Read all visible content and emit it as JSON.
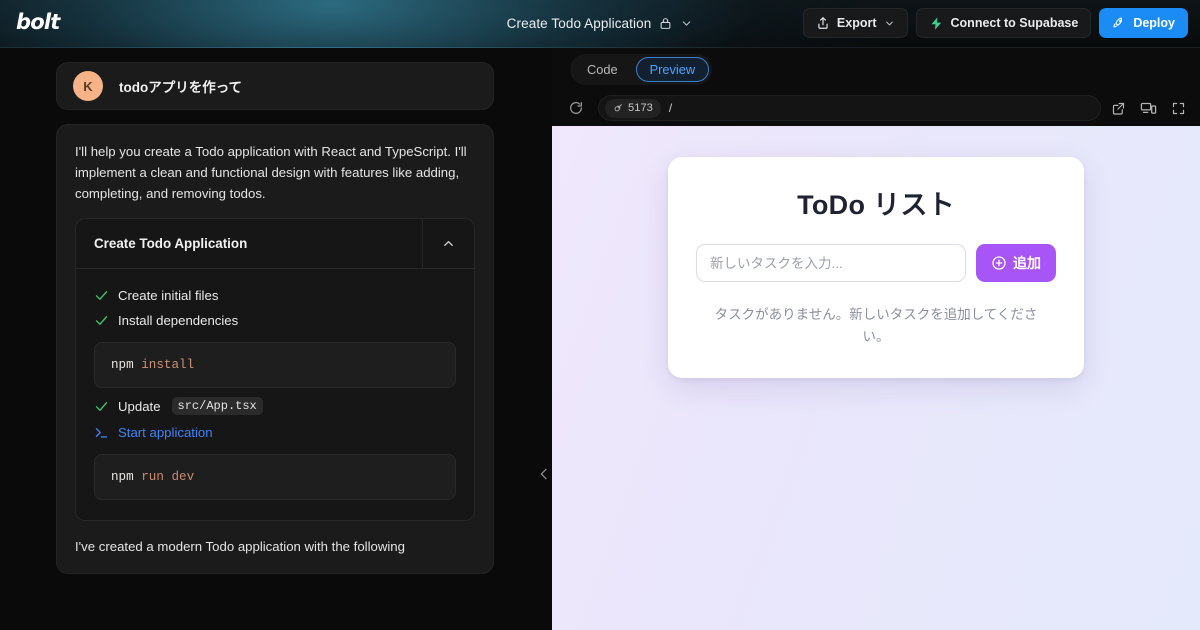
{
  "header": {
    "logo": "bolt",
    "title": "Create Todo Application",
    "lock_icon": "lock-icon",
    "chevron_icon": "chevron-down-icon",
    "export_label": "Export",
    "supabase_label": "Connect to Supabase",
    "deploy_label": "Deploy",
    "accent_blue": "#1b8cf5",
    "supabase_green": "#3ecf8e"
  },
  "chat": {
    "user_message": {
      "avatar_initial": "K",
      "avatar_color": "#f5b387",
      "text": "todoアプリを作って"
    },
    "assistant_intro": "I'll help you create a Todo application with React and TypeScript. I'll implement a clean and functional design with features like adding, completing, and removing todos.",
    "artifact": {
      "title": "Create Todo Application",
      "toggle_icon": "chevron-up-icon",
      "actions": [
        {
          "icon": "check-icon",
          "label": "Create initial files",
          "type": "file"
        },
        {
          "icon": "check-icon",
          "label": "Install dependencies",
          "type": "shell"
        },
        {
          "icon": "check-icon",
          "label": "Update",
          "file": "src/App.tsx",
          "type": "file"
        },
        {
          "icon": "terminal-icon",
          "label": "Start application",
          "type": "start"
        }
      ],
      "code_install": {
        "cmd": "npm",
        "args": "install"
      },
      "code_run": {
        "cmd": "npm",
        "args": "run dev"
      }
    },
    "assistant_outro": "I've created a modern Todo application with the following",
    "collapse_icon": "chevron-left-icon"
  },
  "preview": {
    "tabs": [
      {
        "label": "Code",
        "active": false
      },
      {
        "label": "Preview",
        "active": true
      }
    ],
    "reload_icon": "reload-icon",
    "port_icon": "plug-icon",
    "port": "5173",
    "path": "/",
    "open_external_icon": "external-link-icon",
    "responsive_icon": "device-preview-icon",
    "fullscreen_icon": "fullscreen-icon",
    "app": {
      "title": "ToDo リスト",
      "input_placeholder": "新しいタスクを入力...",
      "input_value": "",
      "add_icon": "plus-circle-icon",
      "add_label": "追加",
      "empty_text": "タスクがありません。新しいタスクを追加してください。",
      "accent": "#a855f7"
    }
  }
}
